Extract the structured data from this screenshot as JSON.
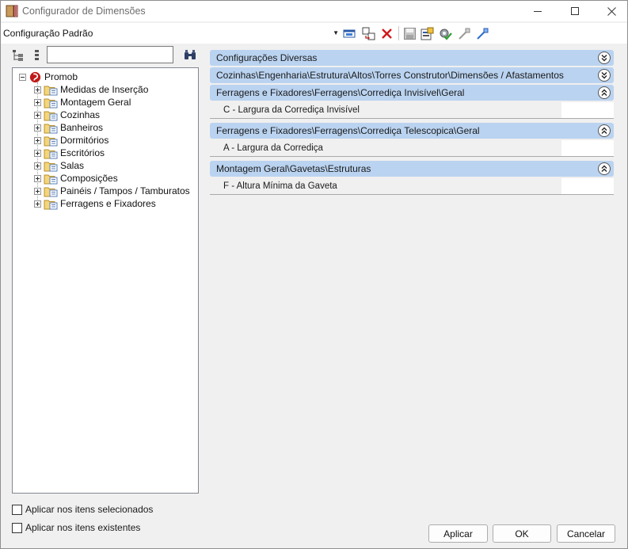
{
  "window": {
    "title": "Configurador de Dimensões"
  },
  "config": {
    "selected": "Configuração Padrão"
  },
  "tree": {
    "search_value": "",
    "root": "Promob",
    "items": [
      {
        "label": "Medidas de Inserção"
      },
      {
        "label": "Montagem Geral"
      },
      {
        "label": "Cozinhas"
      },
      {
        "label": "Banheiros"
      },
      {
        "label": "Dormitórios"
      },
      {
        "label": "Escritórios"
      },
      {
        "label": "Salas"
      },
      {
        "label": "Composições"
      },
      {
        "label": "Painéis / Tampos / Tamburatos"
      },
      {
        "label": "Ferragens e Fixadores"
      }
    ]
  },
  "groups": [
    {
      "title": "Configurações Diversas",
      "expanded": false,
      "rows": []
    },
    {
      "title": "Cozinhas\\Engenharia\\Estrutura\\Altos\\Torres Construtor\\Dimensões / Afastamentos",
      "expanded": false,
      "rows": []
    },
    {
      "title": "Ferragens e Fixadores\\Ferragens\\Corrediça Invisível\\Geral",
      "expanded": true,
      "rows": [
        {
          "label": "C - Largura da Corrediça Invisível",
          "value": ""
        }
      ]
    },
    {
      "title": "Ferragens e Fixadores\\Ferragens\\Corrediça Telescopica\\Geral",
      "expanded": true,
      "rows": [
        {
          "label": "A - Largura da Corrediça",
          "value": ""
        }
      ]
    },
    {
      "title": "Montagem Geral\\Gavetas\\Estruturas",
      "expanded": true,
      "rows": [
        {
          "label": "F - Altura Mínima da Gaveta",
          "value": ""
        }
      ]
    }
  ],
  "options": {
    "apply_selected": "Aplicar nos itens selecionados",
    "apply_existing": "Aplicar nos itens existentes"
  },
  "buttons": {
    "apply": "Aplicar",
    "ok": "OK",
    "cancel": "Cancelar"
  },
  "icons": {
    "app": "ruler-app-icon",
    "minimize": "minimize-icon",
    "maximize": "maximize-icon",
    "close": "close-icon",
    "new": "new-config-icon",
    "copy": "copy-config-icon",
    "delete": "delete-icon",
    "save": "save-icon",
    "export": "export-icon",
    "settings": "settings-check-icon",
    "pick1": "pick-tool-icon",
    "pick2": "pick-tool-blue-icon",
    "expand_tree": "expand-tree-icon",
    "collapse_tree": "collapse-tree-icon",
    "find": "binoculars-icon"
  }
}
